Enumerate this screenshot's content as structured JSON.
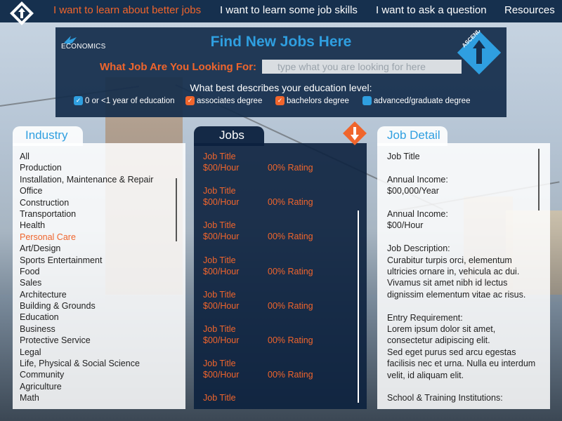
{
  "nav": {
    "items": [
      {
        "label": "I want to learn about better jobs",
        "active": true
      },
      {
        "label": "I want to learn some job skills",
        "active": false
      },
      {
        "label": "I want to ask a question",
        "active": false
      },
      {
        "label": "Resources",
        "active": false
      }
    ]
  },
  "header": {
    "eco_logo_text": "ECONOMICS",
    "ascend_logo_text": "ASCEND NYC",
    "title": "Find New Jobs Here",
    "search_label": "What Job Are You Looking For:",
    "search_placeholder": "type what you are looking for here",
    "search_value": "",
    "education_question": "What best describes your education level:",
    "education_options": [
      {
        "label": "0 or <1 year of education",
        "state": "checked",
        "color": "#2f9fe0"
      },
      {
        "label": "associates degree",
        "state": "checked",
        "color": "#f0652c"
      },
      {
        "label": "bachelors degree",
        "state": "checked",
        "color": "#f0652c"
      },
      {
        "label": "advanced/graduate degree",
        "state": "unchecked",
        "color": "#2f9fe0"
      }
    ]
  },
  "industry": {
    "title": "Industry",
    "selected": "Personal Care",
    "items": [
      "All",
      "Production",
      "Installation, Maintenance & Repair",
      "Office",
      "Construction",
      "Transportation",
      "Health",
      "Personal Care",
      "Art/Design",
      "Sports Entertainment",
      "Food",
      "Sales",
      "Architecture",
      "Building & Grounds",
      "Education",
      "Business",
      "Protective Service",
      "Legal",
      "Life, Physical & Social Science",
      "Community",
      "Agriculture",
      "Math"
    ]
  },
  "jobs": {
    "title": "Jobs",
    "items": [
      {
        "title": "Job Title",
        "pay": "$00/Hour",
        "rating": "00% Rating"
      },
      {
        "title": "Job Title",
        "pay": "$00/Hour",
        "rating": "00% Rating"
      },
      {
        "title": "Job Title",
        "pay": "$00/Hour",
        "rating": "00% Rating"
      },
      {
        "title": "Job Title",
        "pay": "$00/Hour",
        "rating": "00% Rating"
      },
      {
        "title": "Job Title",
        "pay": "$00/Hour",
        "rating": "00% Rating"
      },
      {
        "title": "Job Title",
        "pay": "$00/Hour",
        "rating": "00% Rating"
      },
      {
        "title": "Job Title",
        "pay": "$00/Hour",
        "rating": "00% Rating"
      },
      {
        "title": "Job Title",
        "pay": "",
        "rating": ""
      }
    ]
  },
  "detail": {
    "title": "Job Detail",
    "job_title": "Job Title",
    "annual_label": "Annual Income:",
    "annual_value": "$00,000/Year",
    "hourly_label": "Annual Income:",
    "hourly_value": "$00/Hour",
    "desc_label": "Job Description:",
    "desc_text": "Curabitur turpis orci, elementum ultricies ornare in, vehicula ac dui. Vivamus sit amet nibh id lectus dignissim elementum vitae ac risus.",
    "entry_label": "Entry Requirement:",
    "entry_text1": "Lorem ipsum dolor sit amet, consectetur adipiscing elit.",
    "entry_text2": "Sed eget purus sed arcu egestas facilisis nec et urna. Nulla eu interdum velit, id aliquam elit.",
    "school_label": "School & Training Institutions:"
  },
  "colors": {
    "accent_orange": "#f0652c",
    "accent_blue": "#2f9fe0",
    "navy": "#16304e"
  },
  "icons": {
    "nav_logo": "up-arrow-diamond-icon",
    "ascend_logo": "ascend-nyc-diamond-icon",
    "eco_logo": "eagle-icon",
    "jobs_badge": "down-arrow-diamond-icon"
  }
}
